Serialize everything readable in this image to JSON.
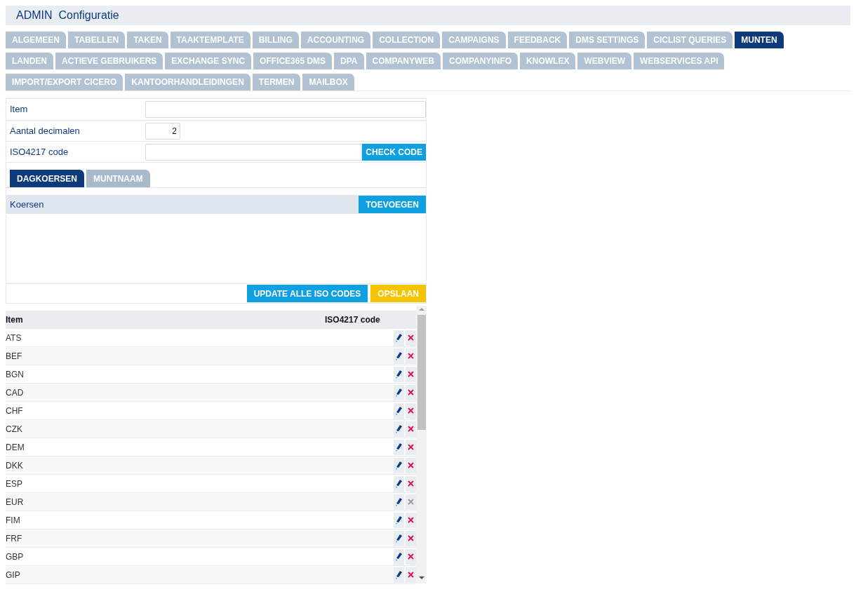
{
  "header": {
    "title": "ADMIN  Configuratie"
  },
  "tab_rows": [
    {
      "tabs": [
        {
          "label": "ALGEMEEN",
          "selected": false
        },
        {
          "label": "TABELLEN",
          "selected": false
        },
        {
          "label": "TAKEN",
          "selected": false
        },
        {
          "label": "TAAKTEMPLATE",
          "selected": false
        },
        {
          "label": "BILLING",
          "selected": false
        },
        {
          "label": "ACCOUNTING",
          "selected": false
        },
        {
          "label": "COLLECTION",
          "selected": false
        },
        {
          "label": "CAMPAIGNS",
          "selected": false
        },
        {
          "label": "FEEDBACK",
          "selected": false
        },
        {
          "label": "DMS SETTINGS",
          "selected": false
        },
        {
          "label": "CICLIST QUERIES",
          "selected": false
        },
        {
          "label": "MUNTEN",
          "selected": true
        }
      ]
    },
    {
      "tabs": [
        {
          "label": "LANDEN",
          "selected": false
        },
        {
          "label": "ACTIEVE GEBRUIKERS",
          "selected": false
        },
        {
          "label": "EXCHANGE SYNC",
          "selected": false
        },
        {
          "label": "OFFICE365 DMS",
          "selected": false
        },
        {
          "label": "DPA",
          "selected": false
        },
        {
          "label": "COMPANYWEB",
          "selected": false
        },
        {
          "label": "COMPANYINFO",
          "selected": false
        },
        {
          "label": "KNOWLEX",
          "selected": false
        },
        {
          "label": "WEBVIEW",
          "selected": false
        },
        {
          "label": "WEBSERVICES API",
          "selected": false
        }
      ]
    },
    {
      "tabs": [
        {
          "label": "IMPORT/EXPORT CICERO",
          "selected": false
        },
        {
          "label": "KANTOORHANDLEIDINGEN",
          "selected": false
        },
        {
          "label": "TERMEN",
          "selected": false
        },
        {
          "label": "MAILBOX",
          "selected": false
        }
      ]
    }
  ],
  "form": {
    "fields": [
      {
        "label": "Item",
        "kind": "text"
      },
      {
        "label": "Aantal decimalen",
        "kind": "number",
        "value": "2"
      },
      {
        "label": "ISO4217 code",
        "kind": "check",
        "button": "CHECK CODE"
      }
    ]
  },
  "sub_tabs": [
    {
      "label": "DAGKOERSEN",
      "selected": true
    },
    {
      "label": "MUNTNAAM",
      "selected": false
    }
  ],
  "rates": {
    "title": "Koersen",
    "button": "TOEVOEGEN"
  },
  "actions": [
    "UPDATE ALLE ISO CODES",
    "OPSLAAN"
  ],
  "table": {
    "columns": [
      "Item",
      "ISO4217 code"
    ],
    "rows": [
      {
        "item": "ATS",
        "delete_disabled": false
      },
      {
        "item": "BEF",
        "delete_disabled": false
      },
      {
        "item": "BGN",
        "delete_disabled": false
      },
      {
        "item": "CAD",
        "delete_disabled": false
      },
      {
        "item": "CHF",
        "delete_disabled": false
      },
      {
        "item": "CZK",
        "delete_disabled": false
      },
      {
        "item": "DEM",
        "delete_disabled": false
      },
      {
        "item": "DKK",
        "delete_disabled": false
      },
      {
        "item": "ESP",
        "delete_disabled": false
      },
      {
        "item": "EUR",
        "delete_disabled": true
      },
      {
        "item": "FIM",
        "delete_disabled": false
      },
      {
        "item": "FRF",
        "delete_disabled": false
      },
      {
        "item": "GBP",
        "delete_disabled": false
      },
      {
        "item": "GIP",
        "delete_disabled": false
      }
    ]
  }
}
